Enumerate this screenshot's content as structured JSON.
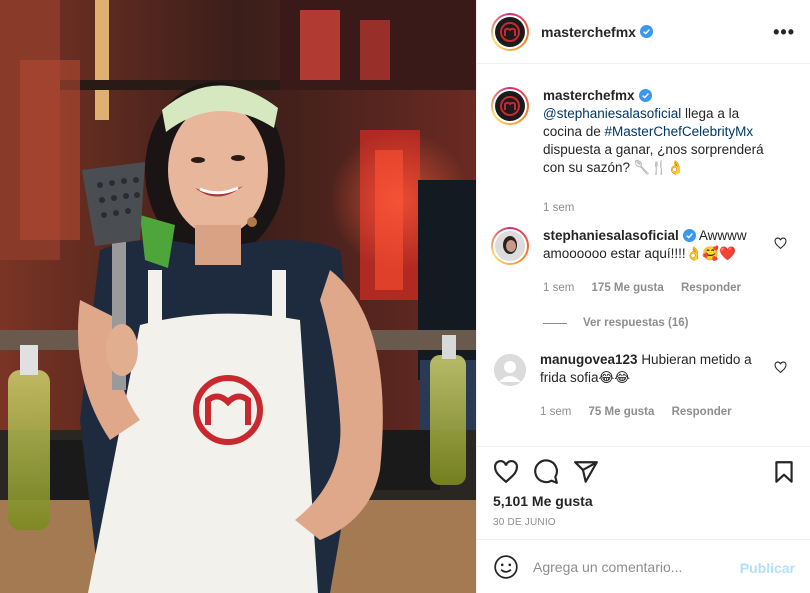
{
  "post": {
    "author": "masterchefmx",
    "verified": true,
    "more_icon": "more-horizontal-icon",
    "caption": {
      "author": "masterchefmx",
      "mention": "@stephaniesalasoficial",
      "text_1": " llega a la cocina de ",
      "hashtag": "#MasterChefCelebrityMx",
      "text_2": " dispuesta a ganar, ¿nos sorprenderá con su sazón? 🥄🍴👌",
      "time": "1 sem"
    },
    "comments": [
      {
        "author": "stephaniesalasoficial",
        "verified": true,
        "text": "Awwww amoooooo estar aquí!!!!👌🥰❤️",
        "time": "1 sem",
        "likes": "175 Me gusta",
        "reply": "Responder",
        "view_replies": "Ver respuestas (16)"
      },
      {
        "author": "manugovea123",
        "verified": false,
        "text": "Hubieran metido a frida sofia😂😂",
        "time": "1 sem",
        "likes": "75 Me gusta",
        "reply": "Responder"
      }
    ],
    "likes_count": "5,101 Me gusta",
    "date": "30 DE JUNIO",
    "add_comment_placeholder": "Agrega un comentario...",
    "publish_label": "Publicar"
  },
  "colors": {
    "brand_red": "#c8282e",
    "verified_blue": "#3897f0",
    "link_blue": "#00376b",
    "muted": "#8e8e8e",
    "publish_disabled": "#b2dffc"
  }
}
